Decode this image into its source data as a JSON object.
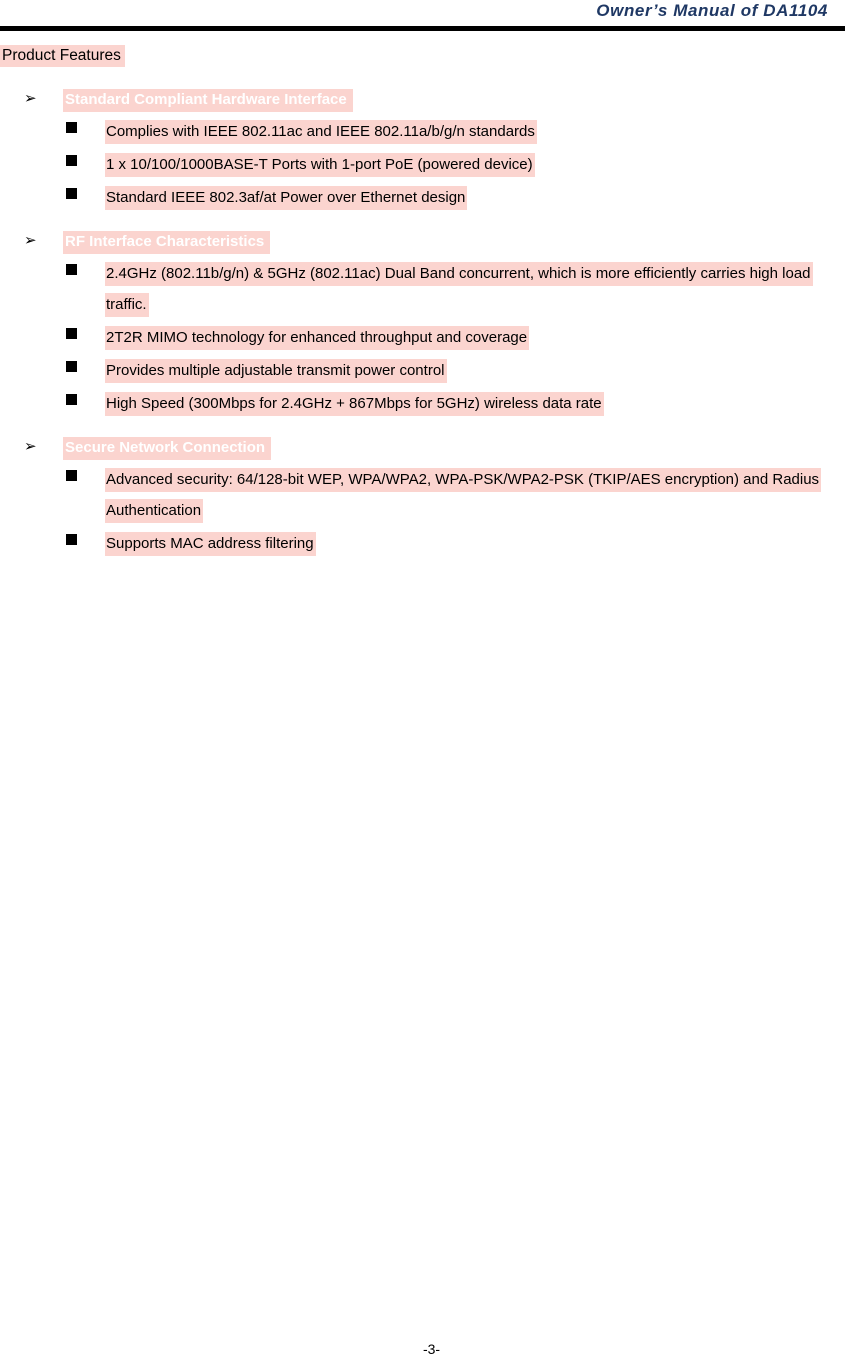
{
  "header": {
    "title": "Owner’s Manual of DA1104",
    "title_color": "#1F3864",
    "rule_color": "#000000"
  },
  "highlight_color": "#FBD4CF",
  "doc": {
    "title": "Product Features"
  },
  "sections": [
    {
      "arrow_glyph": "➢",
      "heading": "Standard Compliant Hardware Interface",
      "items": [
        {
          "bullet_glyph": "■",
          "text": "Complies with IEEE 802.11ac and IEEE 802.11a/b/g/n standards"
        },
        {
          "bullet_glyph": "■",
          "text": "1 x 10/100/1000BASE-T Ports with 1-port PoE (powered device)"
        },
        {
          "bullet_glyph": "■",
          "text": "Standard IEEE 802.3af/at Power over Ethernet design"
        }
      ]
    },
    {
      "arrow_glyph": "➢",
      "heading": "RF Interface Characteristics",
      "items": [
        {
          "bullet_glyph": "■",
          "text": "2.4GHz (802.11b/g/n) & 5GHz (802.11ac) Dual Band concurrent, which is more efficiently carries high load traffic."
        },
        {
          "bullet_glyph": "■",
          "text": "2T2R MIMO technology for enhanced throughput and coverage"
        },
        {
          "bullet_glyph": "■",
          "text": "Provides multiple adjustable transmit power control"
        },
        {
          "bullet_glyph": "■",
          "text": "High Speed (300Mbps for 2.4GHz + 867Mbps for 5GHz) wireless data rate"
        }
      ]
    },
    {
      "arrow_glyph": "➢",
      "heading": "Secure Network Connection",
      "items": [
        {
          "bullet_glyph": "■",
          "text": "Advanced security: 64/128-bit WEP, WPA/WPA2, WPA-PSK/WPA2-PSK (TKIP/AES encryption) and Radius Authentication"
        },
        {
          "bullet_glyph": "■",
          "text": "Supports MAC address filtering"
        }
      ]
    }
  ],
  "footer": {
    "page_number": "-3-"
  }
}
